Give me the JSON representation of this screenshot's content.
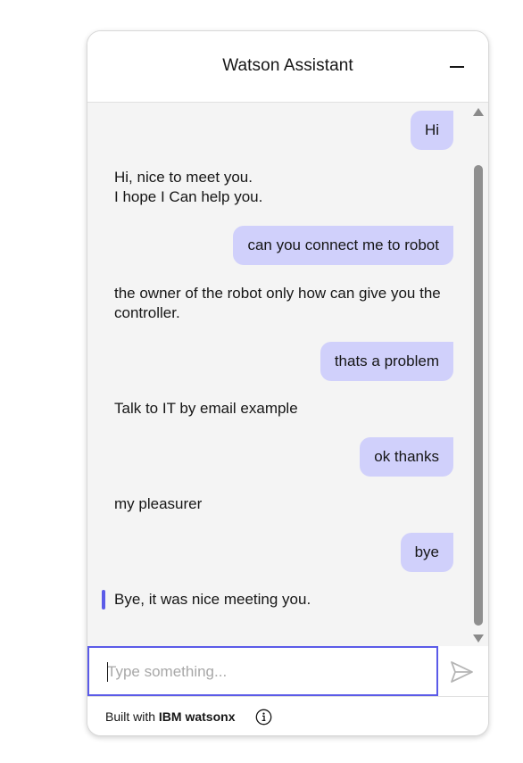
{
  "header": {
    "title": "Watson Assistant",
    "minimize_icon": "minus-icon"
  },
  "conversation": [
    {
      "role": "user",
      "text": "Hi"
    },
    {
      "role": "bot",
      "lines": [
        "Hi, nice to meet you.",
        "I hope I Can help you."
      ]
    },
    {
      "role": "user",
      "text": "can you connect me to robot"
    },
    {
      "role": "bot",
      "lines": [
        "the owner of the robot only how can give you the",
        "controller."
      ]
    },
    {
      "role": "user",
      "text": "thats a problem"
    },
    {
      "role": "bot",
      "lines": [
        "Talk to IT by email example"
      ]
    },
    {
      "role": "user",
      "text": "ok thanks"
    },
    {
      "role": "bot",
      "lines": [
        "my pleasurer"
      ]
    },
    {
      "role": "user",
      "text": "bye"
    },
    {
      "role": "bot",
      "lines": [
        "Bye, it was nice meeting you."
      ],
      "highlighted": true
    }
  ],
  "input": {
    "value": "",
    "placeholder": "Type something...",
    "send_icon": "send-icon"
  },
  "footer": {
    "prefix": "Built with ",
    "brand": "IBM watsonx",
    "info_icon": "info-icon"
  },
  "colors": {
    "user_bubble": "#d0d0fb",
    "accent": "#5b5be8",
    "messages_bg": "#f4f4f4"
  }
}
